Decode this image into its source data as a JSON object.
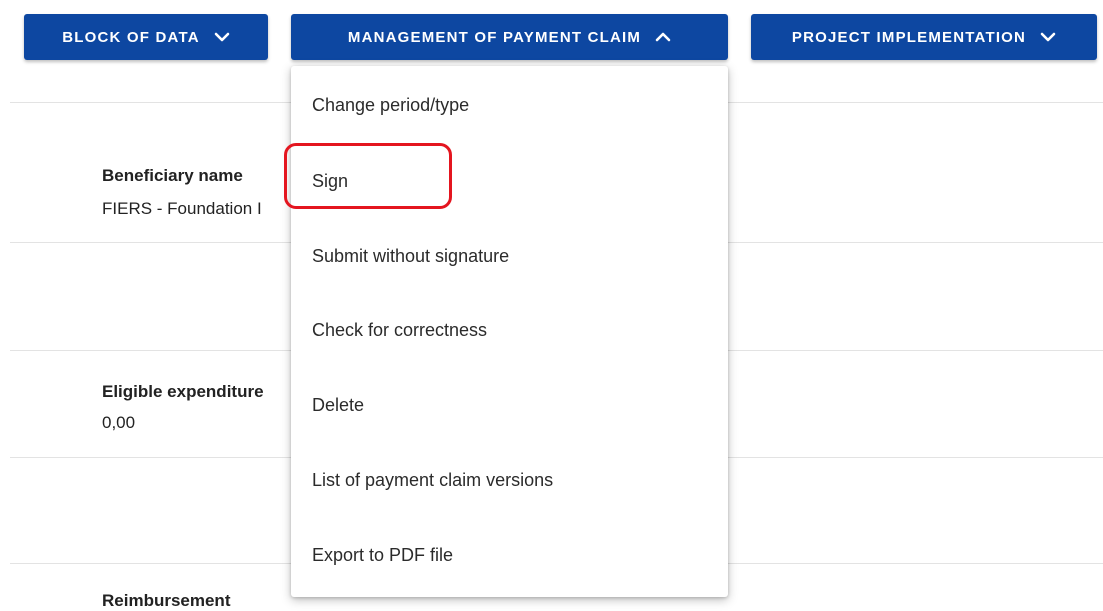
{
  "toolbar": {
    "block_of_data": "BLOCK OF DATA",
    "management": "MANAGEMENT OF PAYMENT CLAIM",
    "project_implementation": "PROJECT IMPLEMENTATION"
  },
  "fields": {
    "beneficiary_label": "Beneficiary name",
    "beneficiary_value": "FIERS - Foundation I",
    "eligible_label": "Eligible expenditure",
    "eligible_value": "0,00",
    "reimbursement_label": "Reimbursement"
  },
  "menu": {
    "items": [
      "Change period/type",
      "Sign",
      "Submit without signature",
      "Check for correctness",
      "Delete",
      "List of payment claim versions",
      "Export to PDF file"
    ]
  },
  "colors": {
    "primary": "#0d47a1",
    "highlight": "#e4151f"
  }
}
